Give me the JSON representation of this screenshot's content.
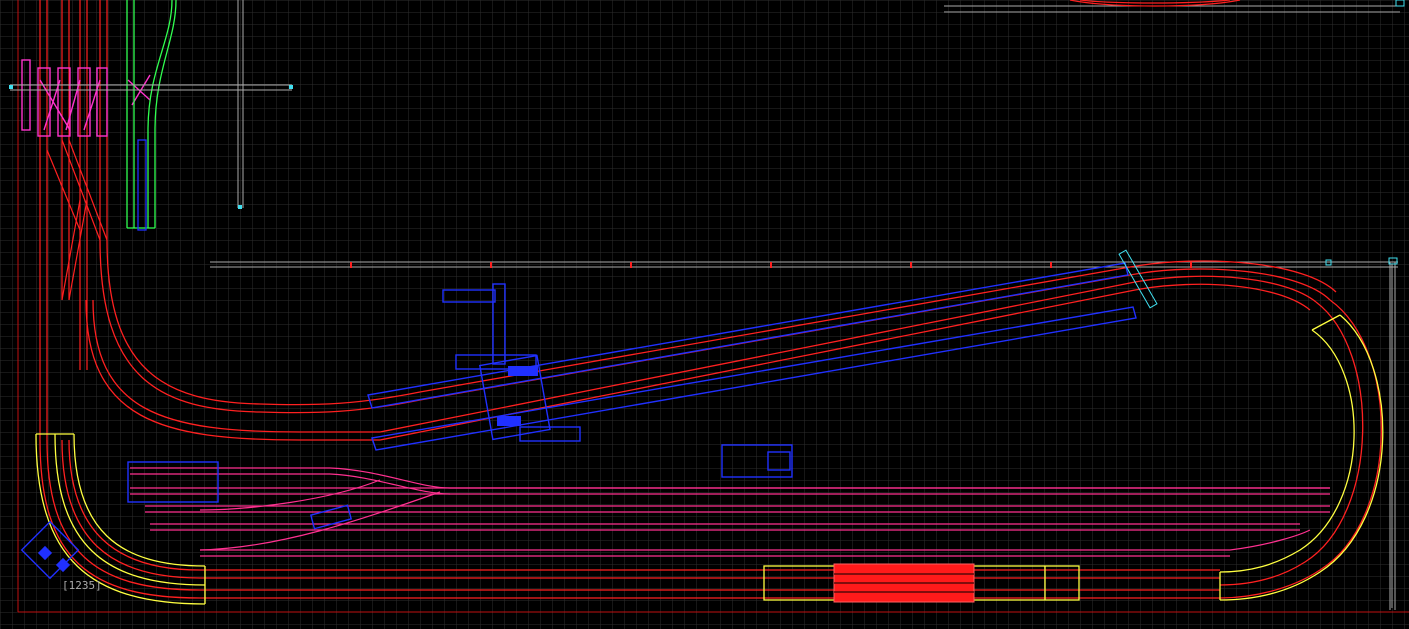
{
  "view": {
    "background": "#000000",
    "grid_color": "#333333",
    "colors": {
      "red": "#ff2020",
      "pink": "#ff3090",
      "magenta": "#ff33cc",
      "yellow": "#ffff40",
      "blue": "#2030ff",
      "green": "#30ff50",
      "cyan": "#40e0f0",
      "grey": "#aaaaaa"
    }
  },
  "labels": {
    "corner_tag": "[1235]"
  }
}
